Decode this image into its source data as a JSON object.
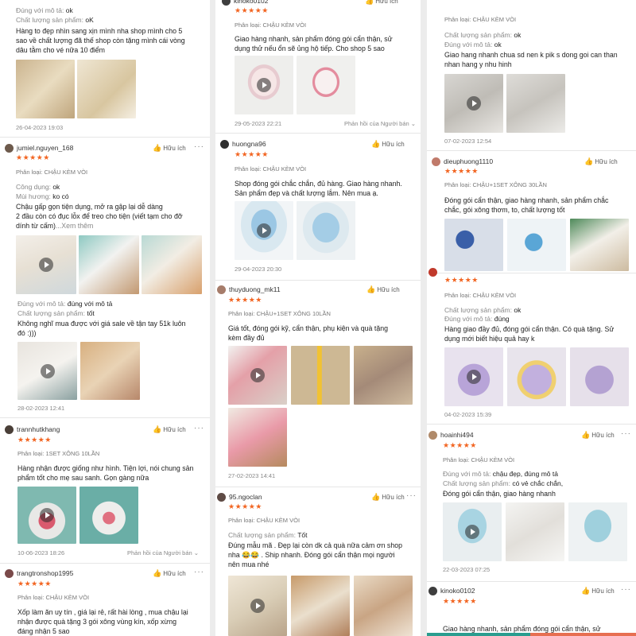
{
  "common": {
    "helpful": "Hữu ích",
    "reply_from_seller": "Phản hồi của Người bán",
    "stars": "★★★★★",
    "more": "···"
  },
  "col1": {
    "r1": {
      "l1": "Đúng với mô tả: ",
      "v1": "ok",
      "l2": "Chất lượng sản phẩm: ",
      "v2": "oK",
      "text": [
        "Hàng to đẹp nhìn sang xịn mình nha shop mình cho 5",
        "sao về chất lượng đã thế shop còn tặng mình cái vòng",
        "dâu tằm cho vé nữa 10 điểm"
      ],
      "date": "26-04-2023 19:03"
    },
    "r2": {
      "user": "jumiel.nguyen_168",
      "cat": "Phân loại: CHẬU KÈM VÒI",
      "l1": "Công dụng: ",
      "v1": "ok",
      "l2": "Mùi hương: ",
      "v2": "ko có",
      "text": [
        "Chậu gấp gọn tiện dụng, mở ra gập lại dễ dàng",
        "2 đầu còn có đục lỗx để treo cho tiện (viết tạm cho đỡ",
        "dính từ cấm)"
      ],
      "see_more": "...Xem thêm",
      "l3": "Đúng với mô tả: ",
      "v3": "đúng với mô tả",
      "l4": "Chất lượng sản phẩm: ",
      "v4": "tốt",
      "text2": [
        "Không nghĩ mua được với giá sale về tận tay 51k luôn",
        "đó :)))"
      ],
      "date": "28-02-2023 12:41"
    },
    "r3": {
      "user": "trannhutkhang",
      "cat": "Phân loại: 1SET XÔNG 10LẦN",
      "text": [
        "Hàng nhận được giống như hình. Tiện lợi, nói chung sản",
        "phẩm tốt cho mẹ sau sanh. Gọn gàng nữa"
      ],
      "date": "10-06-2023 18:26"
    },
    "r4": {
      "user": "trangtronshop1995",
      "cat": "Phân loại: CHẬU KÈM VÒI",
      "text": [
        "Xốp làm ăn uy tín , giá lại rẻ, rất hài lòng , mua chậu lại",
        "nhận được quà tặng 3 gói xông vùng kín, xốp xừng",
        "đáng nhận 5 sao"
      ]
    }
  },
  "col2": {
    "r1": {
      "user": "kinoko0102",
      "cat": "Phân loại: CHẬU KÈM VÒI",
      "text": [
        "Giao hàng nhanh, sản phẩm đóng gói cẩn thận, sử",
        "dụng thử nếu ổn sẽ ủng hộ tiếp. Cho shop 5 sao"
      ],
      "date": "29-05-2023 22:21"
    },
    "r2": {
      "user": "huongna96",
      "cat": "Phân loại: CHẬU KÈM VÒI",
      "text": [
        "Shop đóng gói chắc chắn, đủ hàng. Giao hàng nhanh.",
        "Sản phẩm đẹp và chất lượng lắm. Nên mua ạ."
      ],
      "date": "29-04-2023 20:30"
    },
    "r3": {
      "user": "thuyduong_mk11",
      "cat": "Phân loại: CHẬU+1SET XÔNG 10LẦN",
      "text": [
        "Giá tốt, đóng gói kỹ, cẩn thận, phụ kiện và quà tặng",
        "kèm đầy đủ"
      ],
      "date": "27-02-2023 14:41"
    },
    "r4": {
      "user": "95.ngoclan",
      "cat": "Phân loại: CHẬU KÈM VÒI",
      "l1": "Chất lượng sản phẩm: ",
      "v1": "Tốt",
      "text": [
        "Đúng mẫu mã . Đẹp lại còn dk cả quà nữa cảm ơn shop",
        "nha 😂😂 . Ship nhanh. Đóng gói cẩn thận mọi người",
        "nên mua nhé"
      ]
    }
  },
  "col3": {
    "r1": {
      "cat": "Phân loại: CHẬU KÈM VÒI",
      "l1": "Chất lượng sản phẩm: ",
      "v1": "ok",
      "l2": "Đúng với mô tả: ",
      "v2": "ok",
      "text": [
        "Giao hang nhanh chua sd nen k pik s dong goi can than",
        "nhan hang y nhu hinh"
      ],
      "date": "07-02-2023 12:54"
    },
    "r2": {
      "user": "dieuphuong1110",
      "cat": "Phân loại: CHẬU+1SET XÔNG 30LẦN",
      "text": [
        "Đóng gói cẩn thận, giao hàng nhanh, sản phẩm chắc",
        "chắc, gói xông thơm, to, chất lượng tốt"
      ]
    },
    "r3": {
      "cat": "Phân loại: CHẬU KÈM VÒI",
      "l1": "Chất lượng sản phẩm: ",
      "v1": "ok",
      "l2": "Đúng với mô tả: ",
      "v2": "đúng",
      "text": [
        "Hàng giao đầy đủ, đóng gói cẩn thận. Có quà tặng. Sử",
        "dụng mới biết hiệu quả hay k"
      ],
      "date": "04-02-2023 15:39"
    },
    "r4": {
      "user": "hoainhi494",
      "cat": "Phân loại: CHẬU KÈM VÒI",
      "l1": "Đúng với mô tả: ",
      "v1": "chậu đẹp, đúng mô tả",
      "l2": "Chất lượng sản phẩm: ",
      "v2": "có vẻ chắc chắn,",
      "text": [
        "Đóng gói cẩn thận, giao hàng nhanh"
      ],
      "date": "22-03-2023 07:25"
    },
    "r5": {
      "user": "kinoko0102",
      "text": [
        "Giao hàng nhanh, sản phẩm đóng gói cẩn thận, sử"
      ]
    }
  }
}
